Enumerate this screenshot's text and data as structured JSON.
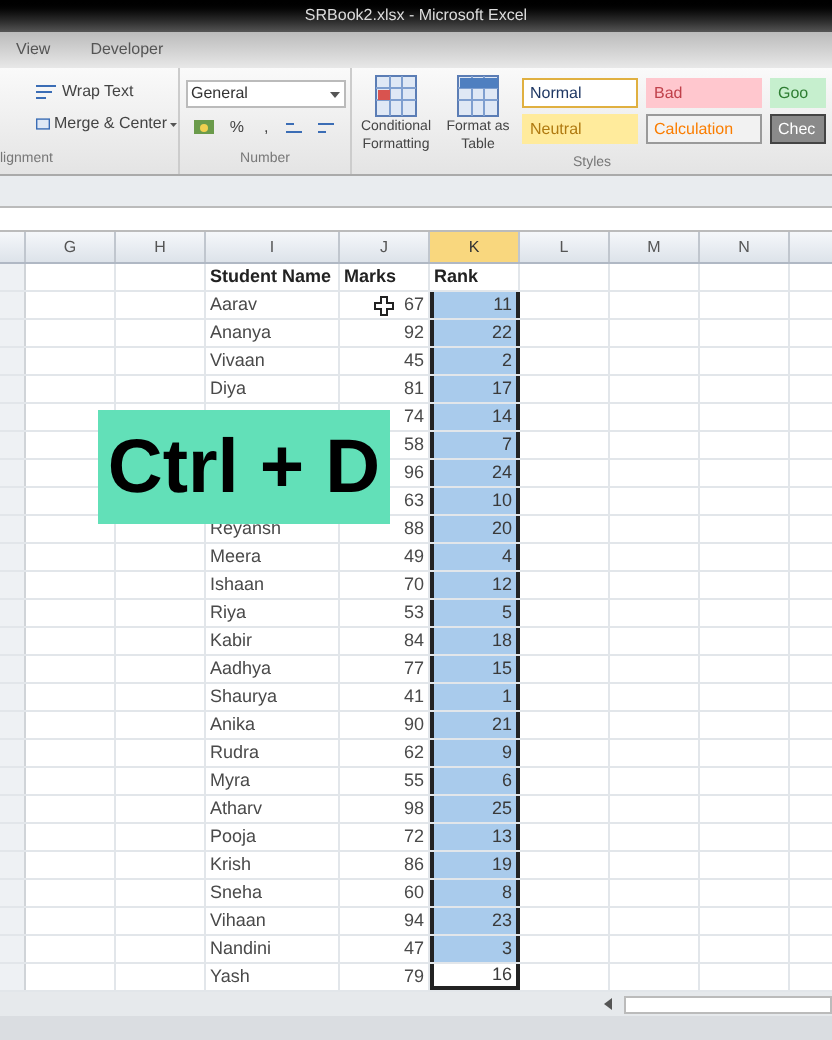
{
  "window": {
    "title": "SRBook2.xlsx - Microsoft Excel"
  },
  "ribbon_tabs": [
    {
      "label": "View"
    },
    {
      "label": "Developer"
    }
  ],
  "alignment": {
    "label": "lignment",
    "buttons": [
      "Wrap Text",
      "Merge & Center"
    ]
  },
  "number": {
    "label": "Number",
    "format": "General",
    "symbols": [
      "%",
      ","
    ]
  },
  "styles": {
    "label": "Styles",
    "buttons": [
      "Conditional Formatting",
      "Format as Table"
    ],
    "cells": [
      {
        "label": "Normal",
        "kind": "normal"
      },
      {
        "label": "Bad",
        "kind": "bad"
      },
      {
        "label": "Goo",
        "kind": "good"
      },
      {
        "label": "Neutral",
        "kind": "neutral"
      },
      {
        "label": "Calculation",
        "kind": "calculation"
      },
      {
        "label": "Chec",
        "kind": "check"
      }
    ]
  },
  "columns": [
    {
      "label": "G",
      "selected": false
    },
    {
      "label": "H",
      "selected": false
    },
    {
      "label": "I",
      "selected": false
    },
    {
      "label": "J",
      "selected": false
    },
    {
      "label": "K",
      "selected": true
    },
    {
      "label": "L",
      "selected": false
    },
    {
      "label": "M",
      "selected": false
    },
    {
      "label": "N",
      "selected": false
    }
  ],
  "table_header": {
    "name": "Student Name",
    "marks": "Marks",
    "rank": "Rank"
  },
  "rows": [
    {
      "name": "Aarav",
      "marks": "67",
      "rank": "11",
      "selected": true,
      "active": false
    },
    {
      "name": "Ananya",
      "marks": "92",
      "rank": "22",
      "selected": true,
      "active": false
    },
    {
      "name": "Vivaan",
      "marks": "45",
      "rank": "2",
      "selected": true,
      "active": false
    },
    {
      "name": "Diya",
      "marks": "81",
      "rank": "17",
      "selected": true,
      "active": false
    },
    {
      "marks": "74",
      "rank": "14",
      "selected": true,
      "active": false
    },
    {
      "marks": "58",
      "rank": "7",
      "selected": true,
      "active": false
    },
    {
      "marks": "96",
      "rank": "24",
      "selected": true,
      "active": false
    },
    {
      "marks": "63",
      "rank": "10",
      "selected": true,
      "active": false
    },
    {
      "name": "Reyansh",
      "marks": "88",
      "rank": "20",
      "selected": true,
      "active": false
    },
    {
      "name": "Meera",
      "marks": "49",
      "rank": "4",
      "selected": true,
      "active": false
    },
    {
      "name": "Ishaan",
      "marks": "70",
      "rank": "12",
      "selected": true,
      "active": false
    },
    {
      "name": "Riya",
      "marks": "53",
      "rank": "5",
      "selected": true,
      "active": false
    },
    {
      "name": "Kabir",
      "marks": "84",
      "rank": "18",
      "selected": true,
      "active": false
    },
    {
      "name": "Aadhya",
      "marks": "77",
      "rank": "15",
      "selected": true,
      "active": false
    },
    {
      "name": "Shaurya",
      "marks": "41",
      "rank": "1",
      "selected": true,
      "active": false
    },
    {
      "name": "Anika",
      "marks": "90",
      "rank": "21",
      "selected": true,
      "active": false
    },
    {
      "name": "Rudra",
      "marks": "62",
      "rank": "9",
      "selected": true,
      "active": false
    },
    {
      "name": "Myra",
      "marks": "55",
      "rank": "6",
      "selected": true,
      "active": false
    },
    {
      "name": "Atharv",
      "marks": "98",
      "rank": "25",
      "selected": true,
      "active": false
    },
    {
      "name": "Pooja",
      "marks": "72",
      "rank": "13",
      "selected": true,
      "active": false
    },
    {
      "name": "Krish",
      "marks": "86",
      "rank": "19",
      "selected": true,
      "active": false
    },
    {
      "name": "Sneha",
      "marks": "60",
      "rank": "8",
      "selected": true,
      "active": false
    },
    {
      "name": "Vihaan",
      "marks": "94",
      "rank": "23",
      "selected": true,
      "active": false
    },
    {
      "name": "Nandini",
      "marks": "47",
      "rank": "3",
      "selected": true,
      "active": false
    },
    {
      "name": "Yash",
      "marks": "79",
      "rank": "16",
      "selected": true,
      "active": true
    }
  ],
  "overlay": {
    "text": "Ctrl + D"
  }
}
